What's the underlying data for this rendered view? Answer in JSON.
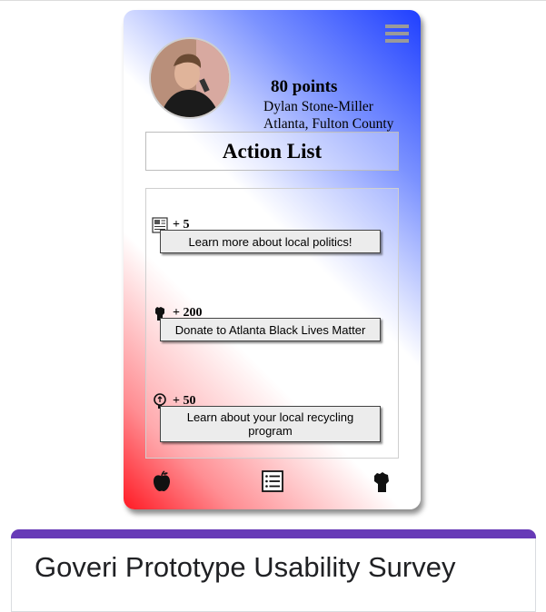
{
  "profile": {
    "points": "80 points",
    "name": "Dylan Stone-Miller",
    "location": "Atlanta, Fulton County"
  },
  "action_list": {
    "title": "Action List",
    "items": [
      {
        "points": "+ 5",
        "label": "Learn more about local politics!",
        "icon": "newspaper-icon"
      },
      {
        "points": "+ 200",
        "label": "Donate to Atlanta Black Lives Matter",
        "icon": "raised-fist-icon"
      },
      {
        "points": "+ 50",
        "label": "Learn about your local recycling program",
        "icon": "recycle-bulb-icon"
      }
    ]
  },
  "bottom_nav": [
    "apple-icon",
    "list-icon",
    "raised-fist-icon"
  ],
  "survey": {
    "title": "Goveri Prototype Usability Survey",
    "accent_color": "#673ab7"
  },
  "colors": {
    "gradient_red": "#ff1a24",
    "gradient_blue": "#1f3fff"
  }
}
